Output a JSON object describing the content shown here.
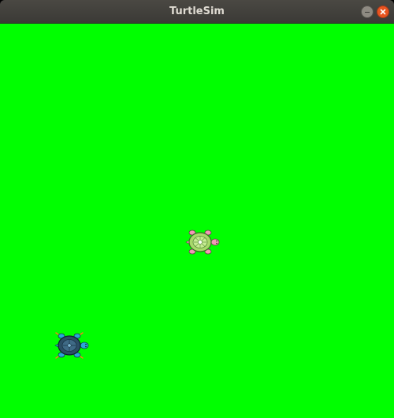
{
  "window": {
    "title": "TurtleSim"
  },
  "canvas": {
    "background_color": "#00ff00"
  },
  "turtles": [
    {
      "icon": "turtle-icon",
      "shell_color": "#a8d86a",
      "heading_deg": 0
    },
    {
      "icon": "turtle-icon",
      "shell_color": "#2c4e66",
      "heading_deg": 0
    }
  ],
  "controls": {
    "minimize_icon": "minimize-icon",
    "close_icon": "close-icon"
  }
}
